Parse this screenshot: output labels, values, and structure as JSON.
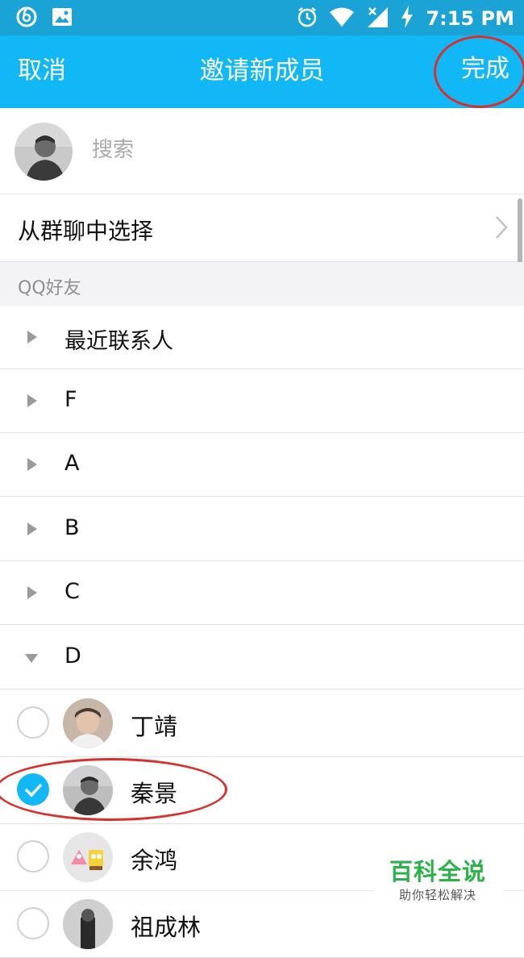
{
  "status_bar": {
    "time": "7:15 PM",
    "left_icons": [
      "netease-music-icon",
      "image-icon"
    ],
    "right_icons": [
      "alarm-icon",
      "wifi-icon",
      "signal-icon",
      "charging-icon"
    ]
  },
  "nav": {
    "cancel_label": "取消",
    "title": "邀请新成员",
    "done_label": "完成"
  },
  "search": {
    "placeholder": "搜索"
  },
  "group_chat_label": "从群聊中选择",
  "section_label": "QQ好友",
  "categories": [
    {
      "label": "最近联系人",
      "expanded": false
    },
    {
      "label": "F",
      "expanded": false
    },
    {
      "label": "A",
      "expanded": false
    },
    {
      "label": "B",
      "expanded": false
    },
    {
      "label": "C",
      "expanded": false
    },
    {
      "label": "D",
      "expanded": true
    }
  ],
  "friends": [
    {
      "name": "丁靖",
      "checked": false
    },
    {
      "name": "秦景",
      "checked": true
    },
    {
      "name": "余鸿",
      "checked": false
    },
    {
      "name": "祖成林",
      "checked": false
    }
  ],
  "watermark": {
    "title": "百科全说",
    "subtitle": "助你轻松解决"
  },
  "colors": {
    "status_bar": "#1ba3d5",
    "nav_bar": "#12b7f5",
    "annotation": "#d9302b",
    "check_selected": "#12b7f5",
    "watermark": "#2bb34a"
  }
}
